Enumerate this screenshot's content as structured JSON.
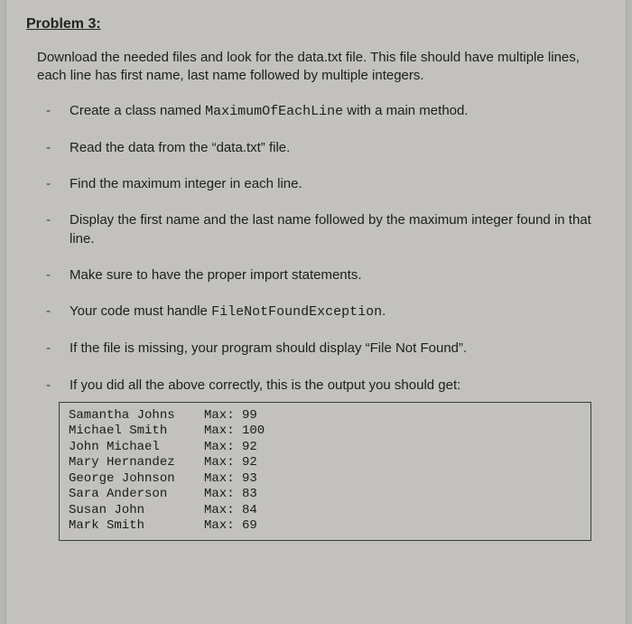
{
  "title": "Problem 3:",
  "intro": "Download the needed files and look for the data.txt file. This file should have multiple lines, each line has first name, last name followed by multiple integers.",
  "bullets": {
    "b0_pre": "Create a class named ",
    "b0_code": "MaximumOfEachLine",
    "b0_post": " with a main method.",
    "b1": "Read the data from the “data.txt” file.",
    "b2": "Find the maximum integer in each line.",
    "b3": "Display the first name and the last name followed by the maximum integer found in that line.",
    "b4": "Make sure to have the proper import statements.",
    "b5_pre": "Your code must handle ",
    "b5_code": "FileNotFoundException",
    "b5_post": ".",
    "b6": "If the file is missing, your program should display “File Not Found”.",
    "b7": "If you did all the above correctly, this is the output you should get:"
  },
  "output": [
    {
      "name": "Samantha Johns",
      "max": "Max: 99"
    },
    {
      "name": "Michael Smith",
      "max": "Max: 100"
    },
    {
      "name": "John Michael",
      "max": "Max: 92"
    },
    {
      "name": "Mary Hernandez",
      "max": "Max: 92"
    },
    {
      "name": "George Johnson",
      "max": "Max: 93"
    },
    {
      "name": "Sara Anderson",
      "max": "Max: 83"
    },
    {
      "name": "Susan John",
      "max": "Max: 84"
    },
    {
      "name": "Mark Smith",
      "max": "Max: 69"
    }
  ]
}
